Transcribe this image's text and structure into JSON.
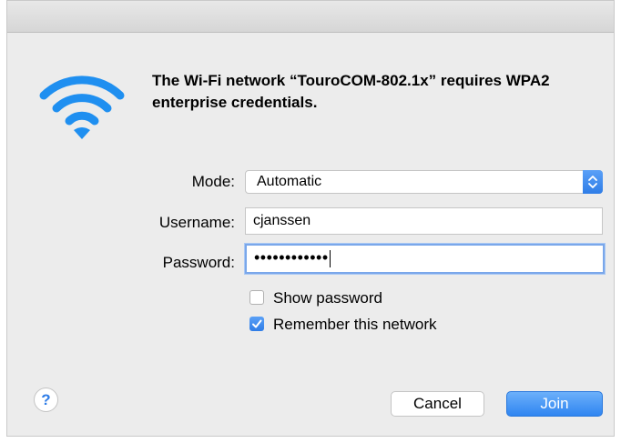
{
  "dialog": {
    "message": "The Wi-Fi network “TouroCOM-802.1x” requires WPA2 enterprise credentials."
  },
  "form": {
    "mode_label": "Mode:",
    "mode_value": "Automatic",
    "username_label": "Username:",
    "username_value": "cjanssen",
    "password_label": "Password:",
    "password_masked": "••••••••••••"
  },
  "options": {
    "show_password": {
      "label": "Show password",
      "checked": false
    },
    "remember_network": {
      "label": "Remember this network",
      "checked": true
    }
  },
  "buttons": {
    "help": "?",
    "cancel": "Cancel",
    "join": "Join"
  },
  "icons": {
    "wifi": "wifi-icon",
    "select_arrows": "updown-chevron-icon",
    "checkmark": "checkmark-icon"
  },
  "colors": {
    "accent": "#2f7de7",
    "wifi_blue": "#1f8ff0",
    "window_bg": "#ececec"
  }
}
